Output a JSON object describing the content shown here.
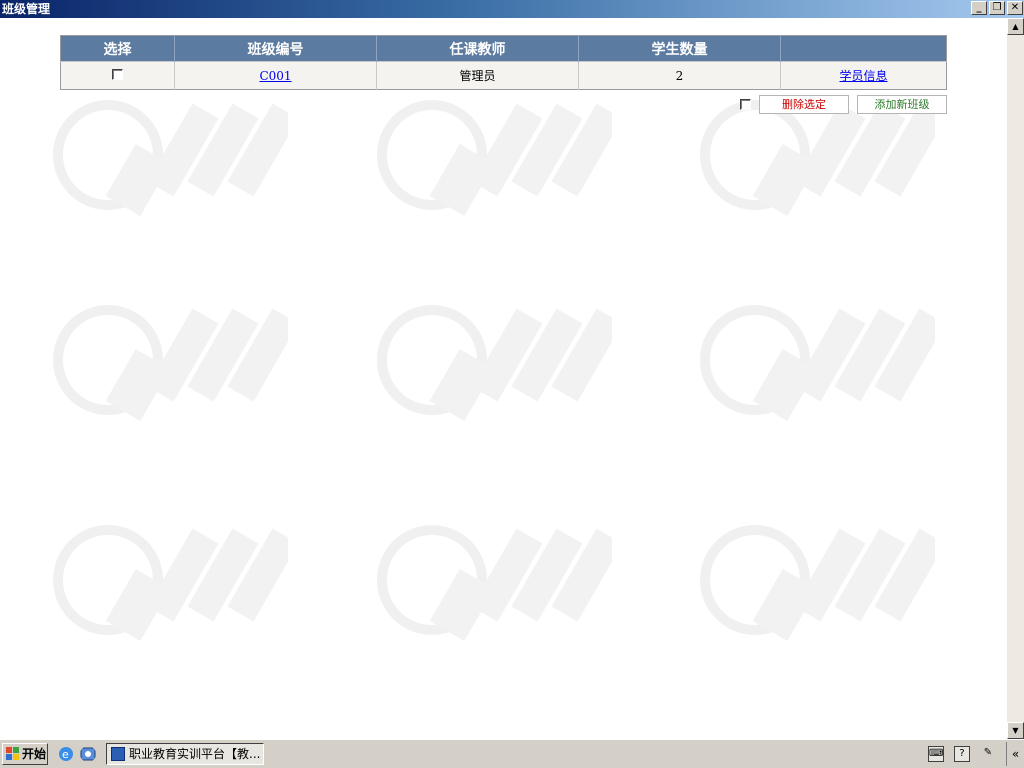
{
  "window": {
    "title": "班级管理"
  },
  "table": {
    "headers": [
      "选择",
      "班级编号",
      "任课教师",
      "学生数量",
      ""
    ],
    "rows": [
      {
        "class_id": "C001",
        "teacher": "管理员",
        "student_count": "2",
        "info_link": "学员信息"
      }
    ]
  },
  "actions": {
    "delete_label": "删除选定",
    "add_label": "添加新班级"
  },
  "taskbar": {
    "start_label": "开始",
    "task_label": "职业教育实训平台【教..."
  },
  "colors": {
    "header_bg": "#5b7ba1",
    "row_bg": "#f4f3ef",
    "delete_text": "#cc0000",
    "add_text": "#2c7a2c",
    "titlebar_start": "#0a246a"
  }
}
